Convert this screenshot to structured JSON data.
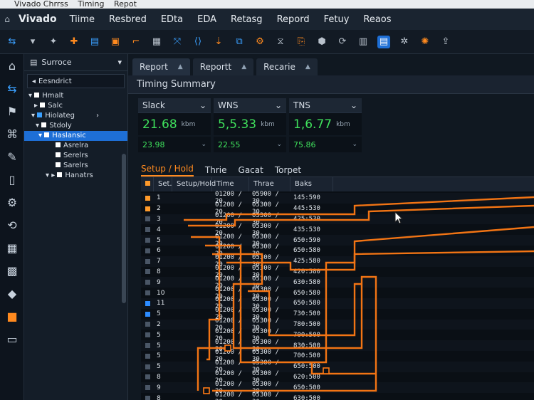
{
  "titlebar": {
    "parts": [
      "Vivado Chrrss",
      "Timing",
      "Repot"
    ]
  },
  "menubar": {
    "brand": "Vivado",
    "items": [
      "Tiime",
      "Resbred",
      "EDta",
      "EDA",
      "Retasg",
      "Repord",
      "Fetuy",
      "Reaos"
    ]
  },
  "source": {
    "header": "Surroce",
    "sub": "Eesndrict",
    "tree": [
      {
        "label": "Hmalt",
        "sel": false
      },
      {
        "label": "Salc",
        "sel": false
      },
      {
        "label": "Hiolateg",
        "sel": false
      },
      {
        "label": "Stdoly",
        "sel": false
      },
      {
        "label": "Haslansic",
        "sel": true
      },
      {
        "label": "Asrelra",
        "sel": false
      },
      {
        "label": "Serelrs",
        "sel": false
      },
      {
        "label": "Sarelrs",
        "sel": false
      },
      {
        "label": "Hanatrs",
        "sel": false
      }
    ]
  },
  "tabs": [
    {
      "label": "Report"
    },
    {
      "label": "Reportt"
    },
    {
      "label": "Recarie"
    }
  ],
  "summary": {
    "title": "Timing Summary",
    "cards": [
      {
        "label": "Slack",
        "value": "21.68",
        "unit": "kbm",
        "sub": "23.98"
      },
      {
        "label": "WNS",
        "value": "5,5.33",
        "unit": "kbm",
        "sub": "22.55"
      },
      {
        "label": "TNS",
        "value": "1,6.77",
        "unit": "kbm",
        "sub": "75.86"
      }
    ]
  },
  "subtabs": [
    "Setup / Hold",
    "Thrie",
    "Gacat",
    "Torpet"
  ],
  "table": {
    "headers": [
      "Set.",
      "Setup/Hold",
      "Time",
      "Thrae",
      "Baks"
    ],
    "rows": [
      {
        "n": "1",
        "time": "01200 / 20",
        "thrae": "05900 / 30",
        "baks": "145:590"
      },
      {
        "n": "2",
        "time": "01200 / 20",
        "thrae": "05300 / 30",
        "baks": "445:530"
      },
      {
        "n": "3",
        "time": "01200 / 20",
        "thrae": "05300 / 30",
        "baks": "425:530"
      },
      {
        "n": "4",
        "time": "01200 / 20",
        "thrae": "05300 / 30",
        "baks": "435:530"
      },
      {
        "n": "5",
        "time": "01200 / 20",
        "thrae": "05300 / 30",
        "baks": "650:590"
      },
      {
        "n": "6",
        "time": "01200 / 20",
        "thrae": "05300 / 30",
        "baks": "650:580"
      },
      {
        "n": "7",
        "time": "01200 / 20",
        "thrae": "05300 / 30",
        "baks": "425:580"
      },
      {
        "n": "8",
        "time": "01200 / 20",
        "thrae": "05300 / 30",
        "baks": "420:580"
      },
      {
        "n": "9",
        "time": "01200 / 20",
        "thrae": "05300 / 30",
        "baks": "630:580"
      },
      {
        "n": "10",
        "time": "01200 / 20",
        "thrae": "05300 / 30",
        "baks": "650:580"
      },
      {
        "n": "11",
        "time": "01200 / 20",
        "thrae": "05300 / 30",
        "baks": "650:580"
      },
      {
        "n": "5",
        "time": "01200 / 20",
        "thrae": "05300 / 30",
        "baks": "730:500"
      },
      {
        "n": "2",
        "time": "01200 / 20",
        "thrae": "05300 / 30",
        "baks": "780:500"
      },
      {
        "n": "5",
        "time": "01200 / 20",
        "thrae": "05300 / 30",
        "baks": "700:500"
      },
      {
        "n": "5",
        "time": "01200 / 20",
        "thrae": "05300 / 30",
        "baks": "830:500"
      },
      {
        "n": "5",
        "time": "01200 / 20",
        "thrae": "05300 / 30",
        "baks": "700:500"
      },
      {
        "n": "5",
        "time": "01200 / 20",
        "thrae": "05300 / 30",
        "baks": "650:500"
      },
      {
        "n": "8",
        "time": "01200 / 20",
        "thrae": "05300 / 30",
        "baks": "620:500"
      },
      {
        "n": "9",
        "time": "01200 / 20",
        "thrae": "05300 / 30",
        "baks": "650:500"
      },
      {
        "n": "8",
        "time": "01200 / 20",
        "thrae": "05300 / 30",
        "baks": "630:500"
      }
    ]
  },
  "colors": {
    "accent": "#ff8a1f",
    "value": "#3fe05c",
    "select": "#1e6fd6"
  }
}
